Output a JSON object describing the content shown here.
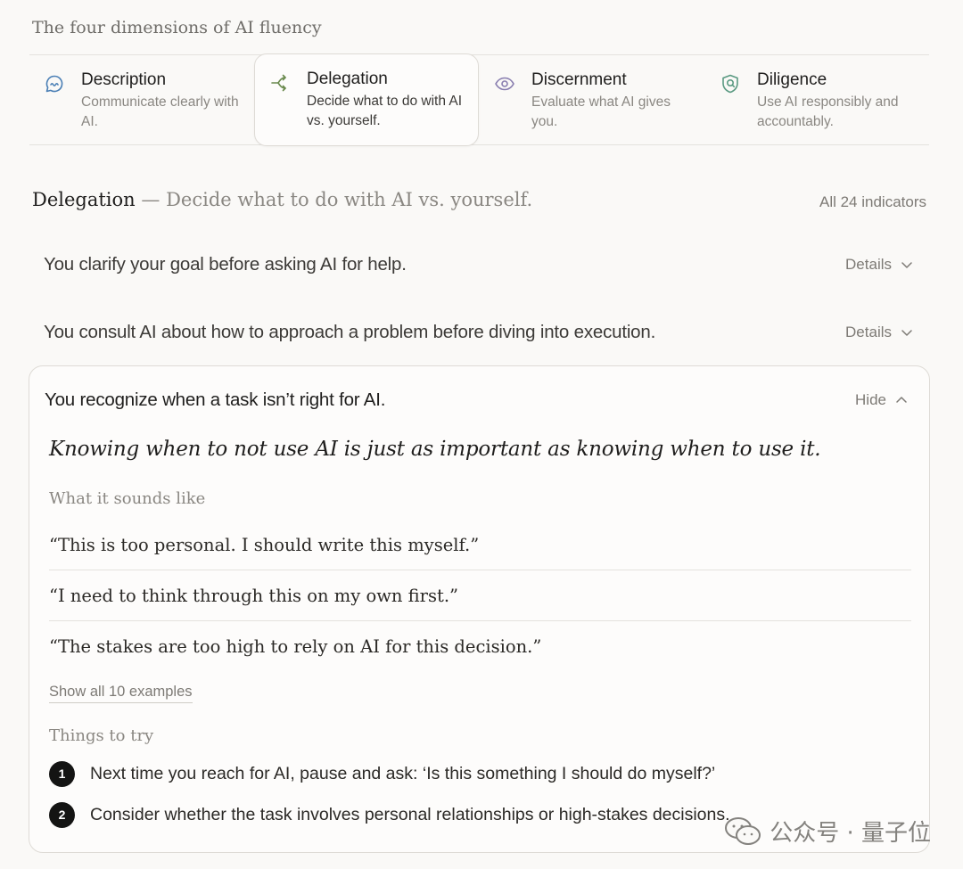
{
  "header": {
    "title": "The four dimensions of AI fluency"
  },
  "dimensions": [
    {
      "title": "Description",
      "desc": "Communicate clearly with AI.",
      "icon": "chat-bubble-icon",
      "color": "#4a7fb5"
    },
    {
      "title": "Delegation",
      "desc": "Decide what to do with AI vs. yourself.",
      "icon": "branch-arrow-icon",
      "color": "#6a8a4e",
      "active": true
    },
    {
      "title": "Discernment",
      "desc": "Evaluate what AI gives you.",
      "icon": "eye-icon",
      "color": "#8a7fb0"
    },
    {
      "title": "Diligence",
      "desc": "Use AI responsibly and accountably.",
      "icon": "shield-icon",
      "color": "#5a9a82"
    }
  ],
  "section": {
    "name": "Delegation",
    "separator": "—",
    "subtitle": "Decide what to do with AI vs. yourself.",
    "all_indicators": "All 24 indicators"
  },
  "indicators": [
    {
      "text": "You clarify your goal before asking AI for help.",
      "toggle": "Details"
    },
    {
      "text": "You consult AI about how to approach a problem before diving into execution.",
      "toggle": "Details"
    }
  ],
  "expanded": {
    "text": "You recognize when a task isn’t right for AI.",
    "toggle": "Hide",
    "lead": "Knowing when to not use AI is just as important as knowing when to use it.",
    "sounds_like_label": "What it sounds like",
    "examples": [
      "“This is too personal. I should write this myself.”",
      "“I need to think through this on my own first.”",
      "“The stakes are too high to rely on AI for this decision.”"
    ],
    "show_all": "Show all 10 examples",
    "things_label": "Things to try",
    "tries": [
      {
        "num": "1",
        "text": "Next time you reach for AI, pause and ask: ‘Is this something I should do myself?’"
      },
      {
        "num": "2",
        "text": "Consider whether the task involves personal relationships or high-stakes decisions."
      }
    ]
  },
  "watermark": {
    "text": "公众号 · 量子位"
  }
}
